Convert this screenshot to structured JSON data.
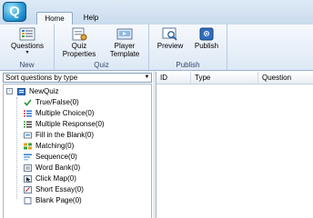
{
  "app": {
    "logo_letter": "Q"
  },
  "tabs": [
    {
      "label": "Home",
      "active": true
    },
    {
      "label": "Help",
      "active": false
    }
  ],
  "ribbon": {
    "groups": [
      {
        "label": "New",
        "buttons": [
          {
            "label": "Questions",
            "icon": "questions-icon",
            "has_dropdown": true
          }
        ]
      },
      {
        "label": "Quiz",
        "buttons": [
          {
            "label": "Quiz Properties",
            "icon": "quiz-properties-icon"
          },
          {
            "label": "Player Template",
            "icon": "player-template-icon"
          }
        ]
      },
      {
        "label": "Publish",
        "buttons": [
          {
            "label": "Preview",
            "icon": "preview-icon"
          },
          {
            "label": "Publish",
            "icon": "publish-icon"
          }
        ]
      }
    ]
  },
  "sort_select": {
    "value": "Sort questions by type"
  },
  "tree": {
    "root": "NewQuiz",
    "items": [
      {
        "label": "True/False(0)",
        "icon": "true-false-icon"
      },
      {
        "label": "Multiple Choice(0)",
        "icon": "multiple-choice-icon"
      },
      {
        "label": "Multiple Response(0)",
        "icon": "multiple-response-icon"
      },
      {
        "label": "Fill in the Blank(0)",
        "icon": "fill-blank-icon"
      },
      {
        "label": "Matching(0)",
        "icon": "matching-icon"
      },
      {
        "label": "Sequence(0)",
        "icon": "sequence-icon"
      },
      {
        "label": "Word Bank(0)",
        "icon": "word-bank-icon"
      },
      {
        "label": "Click Map(0)",
        "icon": "click-map-icon"
      },
      {
        "label": "Short Essay(0)",
        "icon": "short-essay-icon"
      },
      {
        "label": "Blank Page(0)",
        "icon": "blank-page-icon"
      }
    ]
  },
  "list": {
    "columns": [
      "ID",
      "Type",
      "Question"
    ]
  },
  "colors": {
    "accent": "#1a8fd0",
    "ribbon_bg": "#dde8f5",
    "border": "#8ea8c9"
  }
}
